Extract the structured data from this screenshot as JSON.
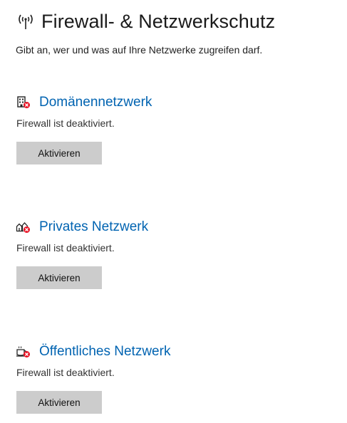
{
  "header": {
    "icon": "wireless-antenna-icon",
    "title": "Firewall- & Netzwerkschutz",
    "subtitle": "Gibt an, wer und was auf Ihre Netzwerke zugreifen darf."
  },
  "networks": [
    {
      "icon": "domain-network-warning-icon",
      "title": "Domänennetzwerk",
      "status": "Firewall ist deaktiviert.",
      "button_label": "Aktivieren"
    },
    {
      "icon": "private-network-warning-icon",
      "title": "Privates Netzwerk",
      "status": "Firewall ist deaktiviert.",
      "button_label": "Aktivieren"
    },
    {
      "icon": "public-network-warning-icon",
      "title": "Öffentliches Netzwerk",
      "status": "Firewall ist deaktiviert.",
      "button_label": "Aktivieren"
    }
  ],
  "colors": {
    "link": "#0063b1",
    "warning_badge": "#e81123",
    "button_bg": "#cccccc"
  }
}
